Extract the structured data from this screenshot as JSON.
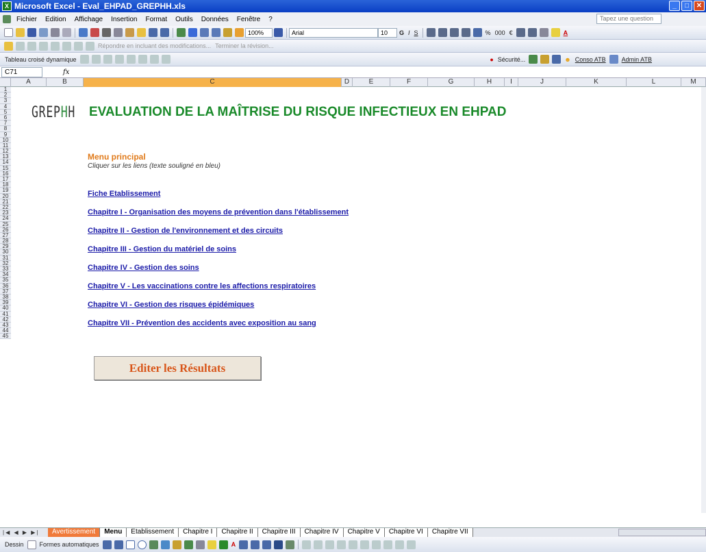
{
  "window": {
    "title": "Microsoft Excel - Eval_EHPAD_GREPHH.xls",
    "app_icon": "excel-icon"
  },
  "menubar": {
    "items": [
      "Fichier",
      "Edition",
      "Affichage",
      "Insertion",
      "Format",
      "Outils",
      "Données",
      "Fenêtre",
      "?"
    ],
    "help_placeholder": "Tapez une question"
  },
  "toolbar": {
    "zoom": "100%",
    "font": "Arial",
    "size": "10",
    "review_reply": "Répondre en incluant des modifications...",
    "review_end": "Terminer la révision...",
    "pivot": "Tableau croisé dynamique",
    "security": "Sécurité...",
    "conso": "Conso ATB",
    "admin": "Admin ATB"
  },
  "formula": {
    "cell": "C71",
    "fx": "fx",
    "value": ""
  },
  "columns": [
    "A",
    "B",
    "C",
    "D",
    "E",
    "F",
    "G",
    "H",
    "I",
    "J",
    "K",
    "L",
    "M"
  ],
  "rows": [
    "1",
    "2",
    "3",
    "4",
    "5",
    "6",
    "7",
    "8",
    "9",
    "10",
    "11",
    "12",
    "13",
    "14",
    "15",
    "16",
    "17",
    "18",
    "19",
    "20",
    "21",
    "22",
    "23",
    "24",
    "25",
    "26",
    "27",
    "28",
    "29",
    "30",
    "31",
    "32",
    "33",
    "34",
    "35",
    "36",
    "37",
    "38",
    "39",
    "40",
    "41",
    "42",
    "43",
    "44",
    "45"
  ],
  "logo": {
    "text_a": "GREP",
    "text_b": "H",
    "text_c": "H"
  },
  "sheet": {
    "title": "EVALUATION DE LA MAÎTRISE DU RISQUE INFECTIEUX EN EHPAD",
    "menu_title": "Menu principal",
    "menu_subtitle": "Cliquer sur les liens (texte souligné en bleu)",
    "links": [
      "Fiche Etablissement",
      "Chapitre I - Organisation des moyens de prévention dans l'établissement",
      "Chapitre II - Gestion de l'environnement et des circuits",
      "Chapitre III - Gestion du matériel de soins",
      "Chapitre IV - Gestion des soins",
      "Chapitre V - Les vaccinations contre les affections respiratoires",
      "Chapitre VI - Gestion des risques épidémiques",
      "Chapitre VII - Prévention des accidents avec exposition au sang"
    ],
    "button": "Editer les Résultats"
  },
  "tabs": [
    "Avertissement",
    "Menu",
    "Etablissement",
    "Chapitre I",
    "Chapitre II",
    "Chapitre III",
    "Chapitre IV",
    "Chapitre V",
    "Chapitre VI",
    "Chapitre VII"
  ],
  "drawbar": {
    "draw": "Dessin",
    "shapes": "Formes automatiques"
  }
}
